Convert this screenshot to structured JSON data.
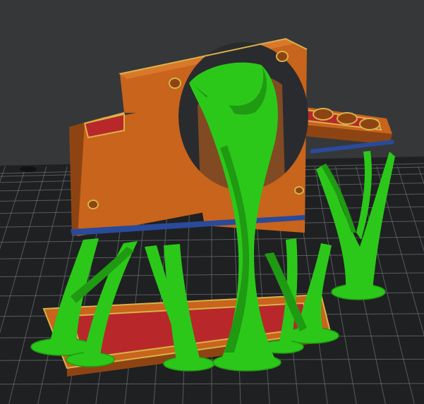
{
  "viewport": {
    "type": "slicer-layer-preview",
    "background_color": "#363739",
    "bed_color": "#1f2022",
    "grid_color": "#6b6d72"
  },
  "model": {
    "part_color": "#c8641c",
    "part_shadow_color": "#8e4412",
    "part_highlight_color": "#d9782a",
    "solid_infill_color": "#b8282a",
    "perimeter_edge_color": "#d8b24a",
    "support_color": "#2bc81a",
    "support_dark_color": "#1f9a12",
    "interface_color": "#2a4a9a"
  }
}
